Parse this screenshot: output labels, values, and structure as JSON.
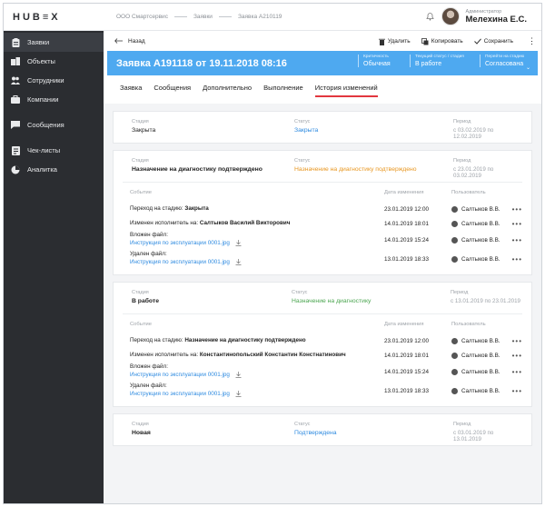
{
  "sidebar": {
    "logo": "HUB≡X",
    "items": [
      {
        "label": "Заявки",
        "icon": "clipboard-icon"
      },
      {
        "label": "Объекты",
        "icon": "buildings-icon"
      },
      {
        "label": "Сотрудники",
        "icon": "users-icon"
      },
      {
        "label": "Компании",
        "icon": "briefcase-icon"
      },
      {
        "label": "Сообщения",
        "icon": "chat-icon"
      },
      {
        "label": "Чек-листы",
        "icon": "checklist-icon"
      },
      {
        "label": "Аналитка",
        "icon": "pie-chart-icon"
      }
    ]
  },
  "topbar": {
    "breadcrumb": [
      "ООО Смартсервис",
      "Заявки",
      "Заявка А210119"
    ],
    "user_role": "Администратор",
    "user_name": "Мелехина Е.С."
  },
  "toolbar": {
    "back_label": "Назад",
    "delete_label": "Удалить",
    "copy_label": "Копировать",
    "save_label": "Сохранить"
  },
  "banner": {
    "title": "Заявка А191118 от 19.11.2018 08:16",
    "criticality_label": "Критичность",
    "criticality_value": "Обычная",
    "status_label": "Текущий статус / стадия",
    "status_value": "В работе",
    "next_label": "Перейти на стадию",
    "next_value": "Согласована"
  },
  "tabs": [
    "Заявка",
    "Сообщения",
    "Дополнительно",
    "Выполнение",
    "История изменений"
  ],
  "labels": {
    "stage": "Стадия",
    "status": "Статус",
    "period": "Период",
    "event": "Событие",
    "change_date": "Дата изменения",
    "user": "Пользователь"
  },
  "stages": [
    {
      "stage": "Закрыта",
      "status": "Закрыта",
      "period": "с 03.02.2019 по 12.02.2019"
    },
    {
      "stage": "Назначение на диагностику подтверждено",
      "status": "Назначение на диагностику подтверждено",
      "period": "с 23.01.2019 по 03.02.2019",
      "events": [
        {
          "text": "Переход на стадию: ",
          "strong": "Закрыта",
          "date": "23.01.2019 12:00",
          "user": "Салтыков В.В."
        },
        {
          "text": "Изменен исполнитель на: ",
          "strong": "Салтыков Василий Викторович",
          "date": "14.01.2019 18:01",
          "user": "Салтыков В.В."
        },
        {
          "text": "Вложен файл:",
          "link": "Инструкция по эксплуатации 0001.jpg",
          "date": "14.01.2019 15:24",
          "user": "Салтыков В.В."
        },
        {
          "text": "Удален файл:",
          "link": "Инструкция по эксплуатации 0001.jpg",
          "date": "13.01.2019 18:33",
          "user": "Салтыков В.В."
        }
      ]
    },
    {
      "stage": "В работе",
      "status": "Назначение на диагностику",
      "period": "с 13.01.2019 по 23.01.2019",
      "events": [
        {
          "text": "Переход на стадию: ",
          "strong": "Назначение на диагностику подтверждено",
          "date": "23.01.2019 12:00",
          "user": "Салтыков В.В."
        },
        {
          "text": "Изменен исполнитель на: ",
          "strong": "Константинопольский Константин Констнатинович",
          "date": "14.01.2019 18:01",
          "user": "Салтыков В.В."
        },
        {
          "text": "Вложен файл:",
          "link": "Инструкция по эксплуатации 0001.jpg",
          "date": "14.01.2019 15:24",
          "user": "Салтыков В.В."
        },
        {
          "text": "Удален файл:",
          "link": "Инструкция по эксплуатации 0001.jpg",
          "date": "13.01.2019 18:33",
          "user": "Салтыков В.В."
        }
      ]
    },
    {
      "stage": "Новая",
      "status": "Подтверждена",
      "period": "с 03.01.2019 по 13.01.2019"
    }
  ]
}
